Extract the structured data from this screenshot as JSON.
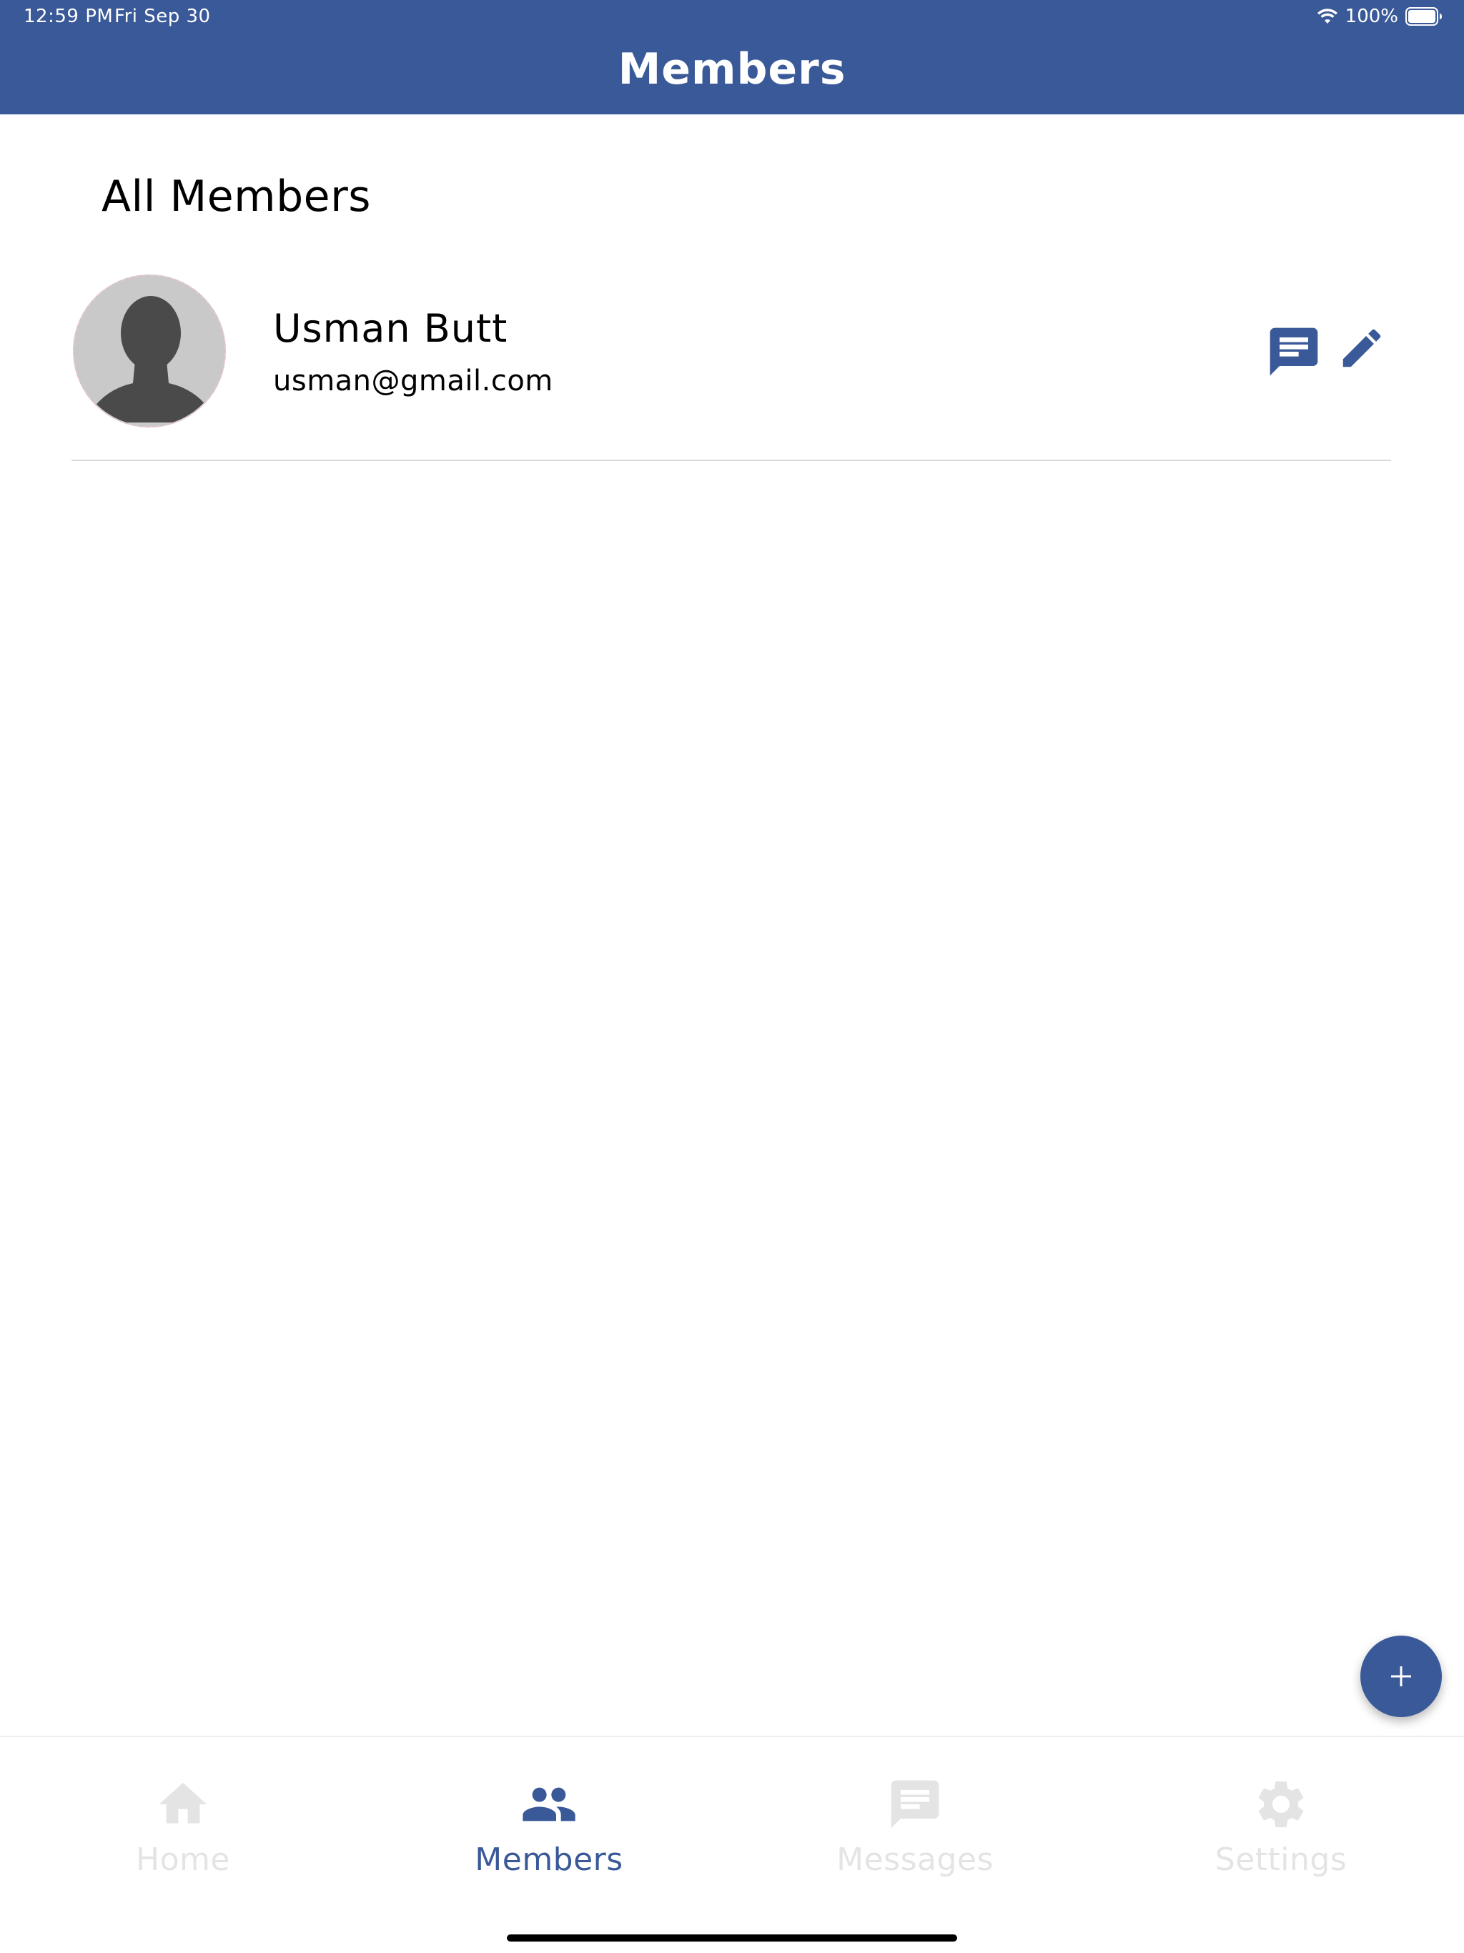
{
  "status_bar": {
    "time": "12:59 PM",
    "date": "Fri Sep 30",
    "battery": "100%"
  },
  "header": {
    "title": "Members"
  },
  "section": {
    "title": "All Members"
  },
  "members": [
    {
      "name": "Usman Butt",
      "email": "usman@gmail.com"
    }
  ],
  "tabs": [
    {
      "label": "Home",
      "icon": "home-icon",
      "active": false
    },
    {
      "label": "Members",
      "icon": "members-icon",
      "active": true
    },
    {
      "label": "Messages",
      "icon": "messages-icon",
      "active": false
    },
    {
      "label": "Settings",
      "icon": "settings-icon",
      "active": false
    }
  ],
  "colors": {
    "primary": "#3a5998",
    "inactive_tab": "#e4e4e4",
    "divider": "#d8d8d8"
  }
}
